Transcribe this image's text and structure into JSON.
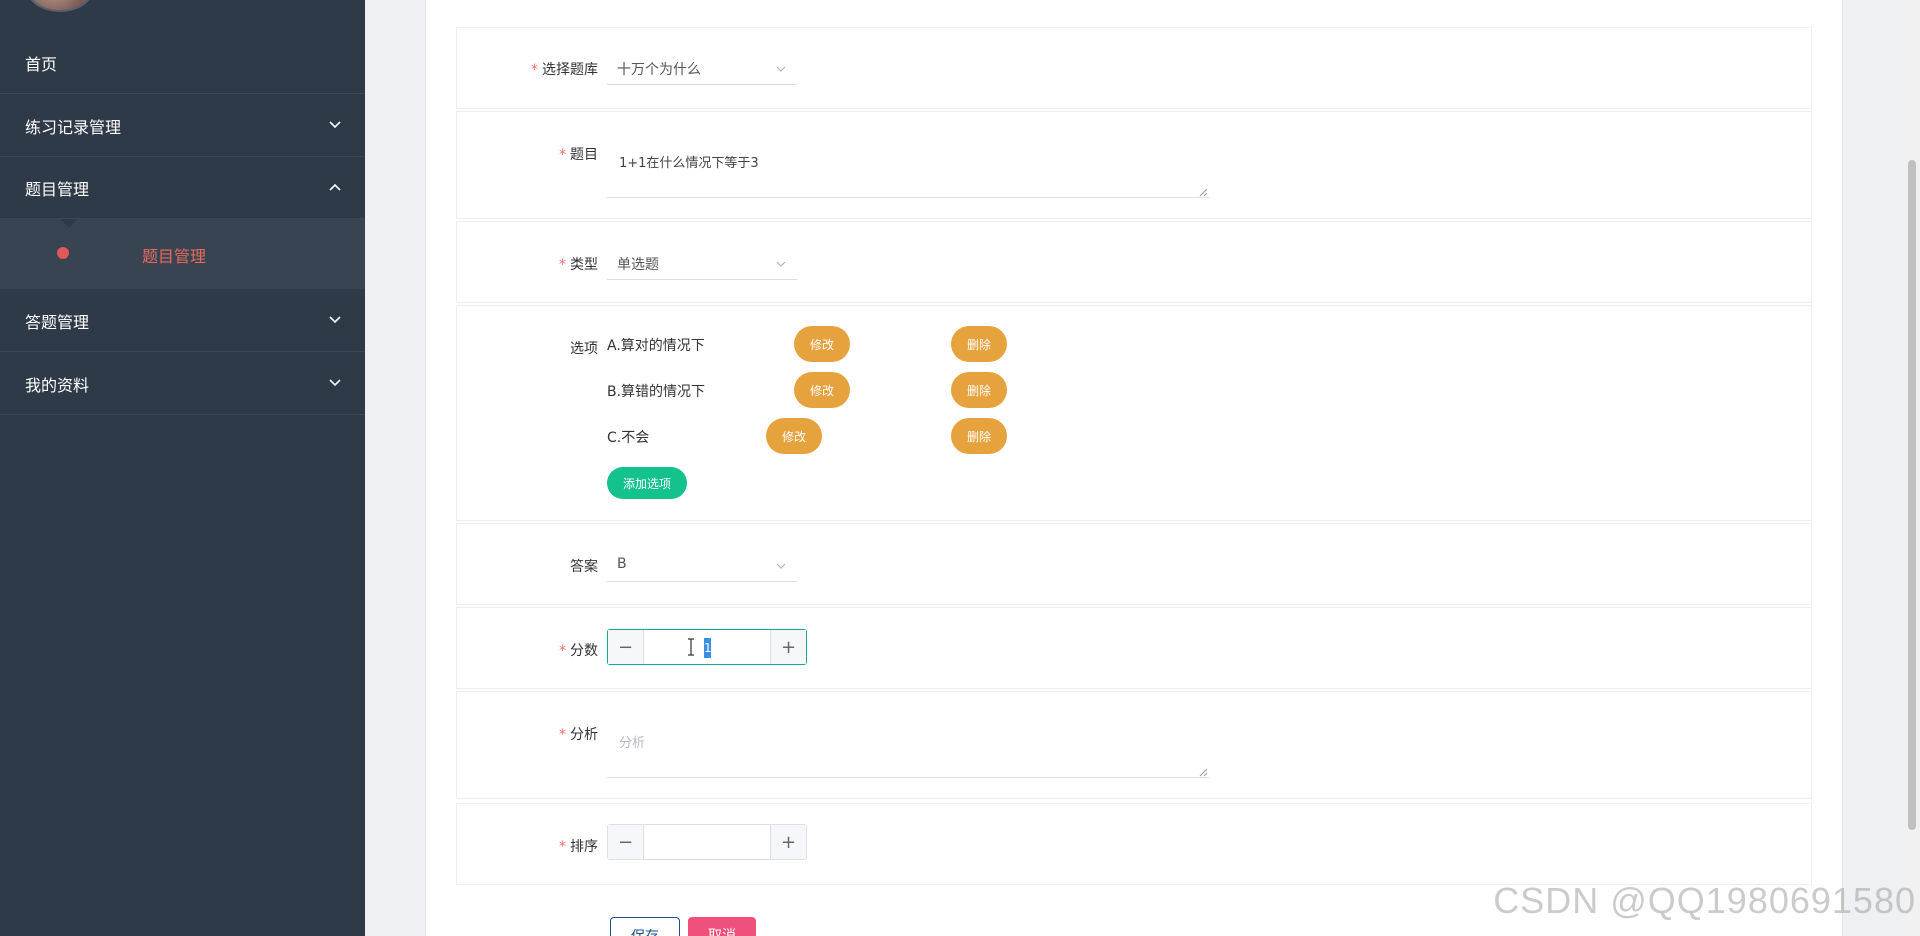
{
  "sidebar": {
    "items": [
      {
        "label": "首页"
      },
      {
        "label": "练习记录管理"
      },
      {
        "label": "题目管理"
      },
      {
        "label": "答题管理"
      },
      {
        "label": "我的资料"
      }
    ],
    "submenu_label": "题目管理"
  },
  "form": {
    "bank": {
      "label": "选择题库",
      "value": "十万个为什么"
    },
    "question": {
      "label": "题目",
      "value": "1+1在什么情况下等于3"
    },
    "type": {
      "label": "类型",
      "value": "单选题"
    },
    "options": {
      "label": "选项",
      "items": [
        {
          "text": "A.算对的情况下",
          "edit": "修改",
          "delete": "删除"
        },
        {
          "text": "B.算错的情况下",
          "edit": "修改",
          "delete": "删除"
        },
        {
          "text": "C.不会",
          "edit": "修改",
          "delete": "删除"
        }
      ],
      "add_label": "添加选项"
    },
    "answer": {
      "label": "答案",
      "value": "B"
    },
    "score": {
      "label": "分数",
      "value": "1",
      "minus": "−",
      "plus": "+"
    },
    "analysis": {
      "label": "分析",
      "placeholder": "分析"
    },
    "order": {
      "label": "排序",
      "value": "",
      "minus": "−",
      "plus": "+"
    },
    "save_label": "保存",
    "cancel_label": "取消"
  },
  "watermark": "CSDN @QQ1980691580",
  "colors": {
    "sidebar": "#2f3a48",
    "accent_orange": "#e6a23c",
    "accent_green": "#13c28d",
    "cancel_pink": "#f0517c",
    "active_red": "#e15a5a"
  }
}
